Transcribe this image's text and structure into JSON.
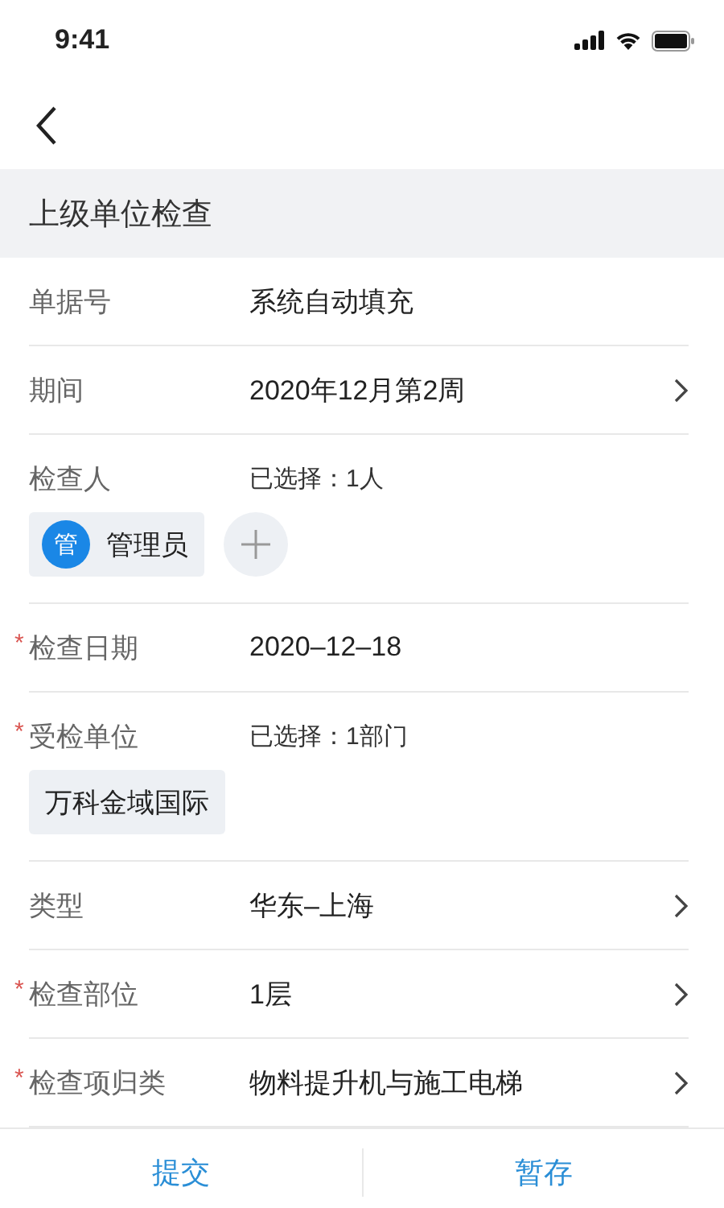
{
  "status_bar": {
    "time": "9:41"
  },
  "section": {
    "title": "上级单位检查"
  },
  "fields": [
    {
      "kind": "text",
      "label": "单据号",
      "value": "系统自动填充",
      "arrow": false
    },
    {
      "kind": "text",
      "label": "期间",
      "value": "2020年12月第2周",
      "arrow": true
    },
    {
      "kind": "people",
      "label": "检查人",
      "summary": "已选择：1人",
      "people": [
        {
          "initial": "管",
          "name": "管理员"
        }
      ]
    },
    {
      "kind": "text",
      "mark": "*",
      "label": "检查日期",
      "value": "2020–12–18",
      "arrow": false
    },
    {
      "kind": "tags",
      "mark": "*",
      "label": "受检单位",
      "summary": "已选择：1部门",
      "tags": [
        "万科金域国际"
      ]
    },
    {
      "kind": "text",
      "label": "类型",
      "value": "华东–上海",
      "arrow": true
    },
    {
      "kind": "text",
      "mark": "*",
      "label": "检查部位",
      "value": "1层",
      "arrow": true
    },
    {
      "kind": "text",
      "mark": "*",
      "label": "检查项归类",
      "value": "物料提升机与施工电梯",
      "arrow": true
    }
  ],
  "buttons": [
    "提交",
    "暂存"
  ]
}
